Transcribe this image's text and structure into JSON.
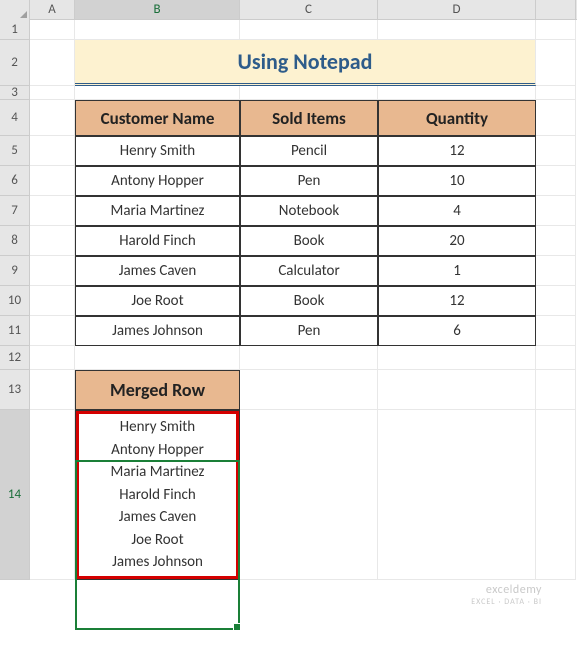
{
  "columns": [
    "A",
    "B",
    "C",
    "D"
  ],
  "row_labels": [
    "1",
    "2",
    "3",
    "4",
    "5",
    "6",
    "7",
    "8",
    "9",
    "10",
    "11",
    "12",
    "13",
    "14"
  ],
  "title": "Using Notepad",
  "headers": {
    "customer": "Customer Name",
    "sold": "Sold Items",
    "qty": "Quantity"
  },
  "chart_data": {
    "type": "table",
    "columns": [
      "Customer Name",
      "Sold Items",
      "Quantity"
    ],
    "rows": [
      {
        "customer": "Henry Smith",
        "sold": "Pencil",
        "qty": 12
      },
      {
        "customer": "Antony Hopper",
        "sold": "Pen",
        "qty": 10
      },
      {
        "customer": "Maria Martinez",
        "sold": "Notebook",
        "qty": 4
      },
      {
        "customer": "Harold Finch",
        "sold": "Book",
        "qty": 20
      },
      {
        "customer": "James Caven",
        "sold": "Calculator",
        "qty": 1
      },
      {
        "customer": "Joe Root",
        "sold": "Book",
        "qty": 12
      },
      {
        "customer": "James Johnson",
        "sold": "Pen",
        "qty": 6
      }
    ]
  },
  "merged_header": "Merged Row",
  "merged_values": [
    "Henry Smith",
    "Antony Hopper",
    "Maria Martinez",
    "Harold Finch",
    "James Caven",
    "Joe Root",
    "James Johnson"
  ],
  "watermark": {
    "brand": "exceldemy",
    "tag": "EXCEL · DATA · BI"
  },
  "active": {
    "col": "B",
    "row": "14"
  }
}
